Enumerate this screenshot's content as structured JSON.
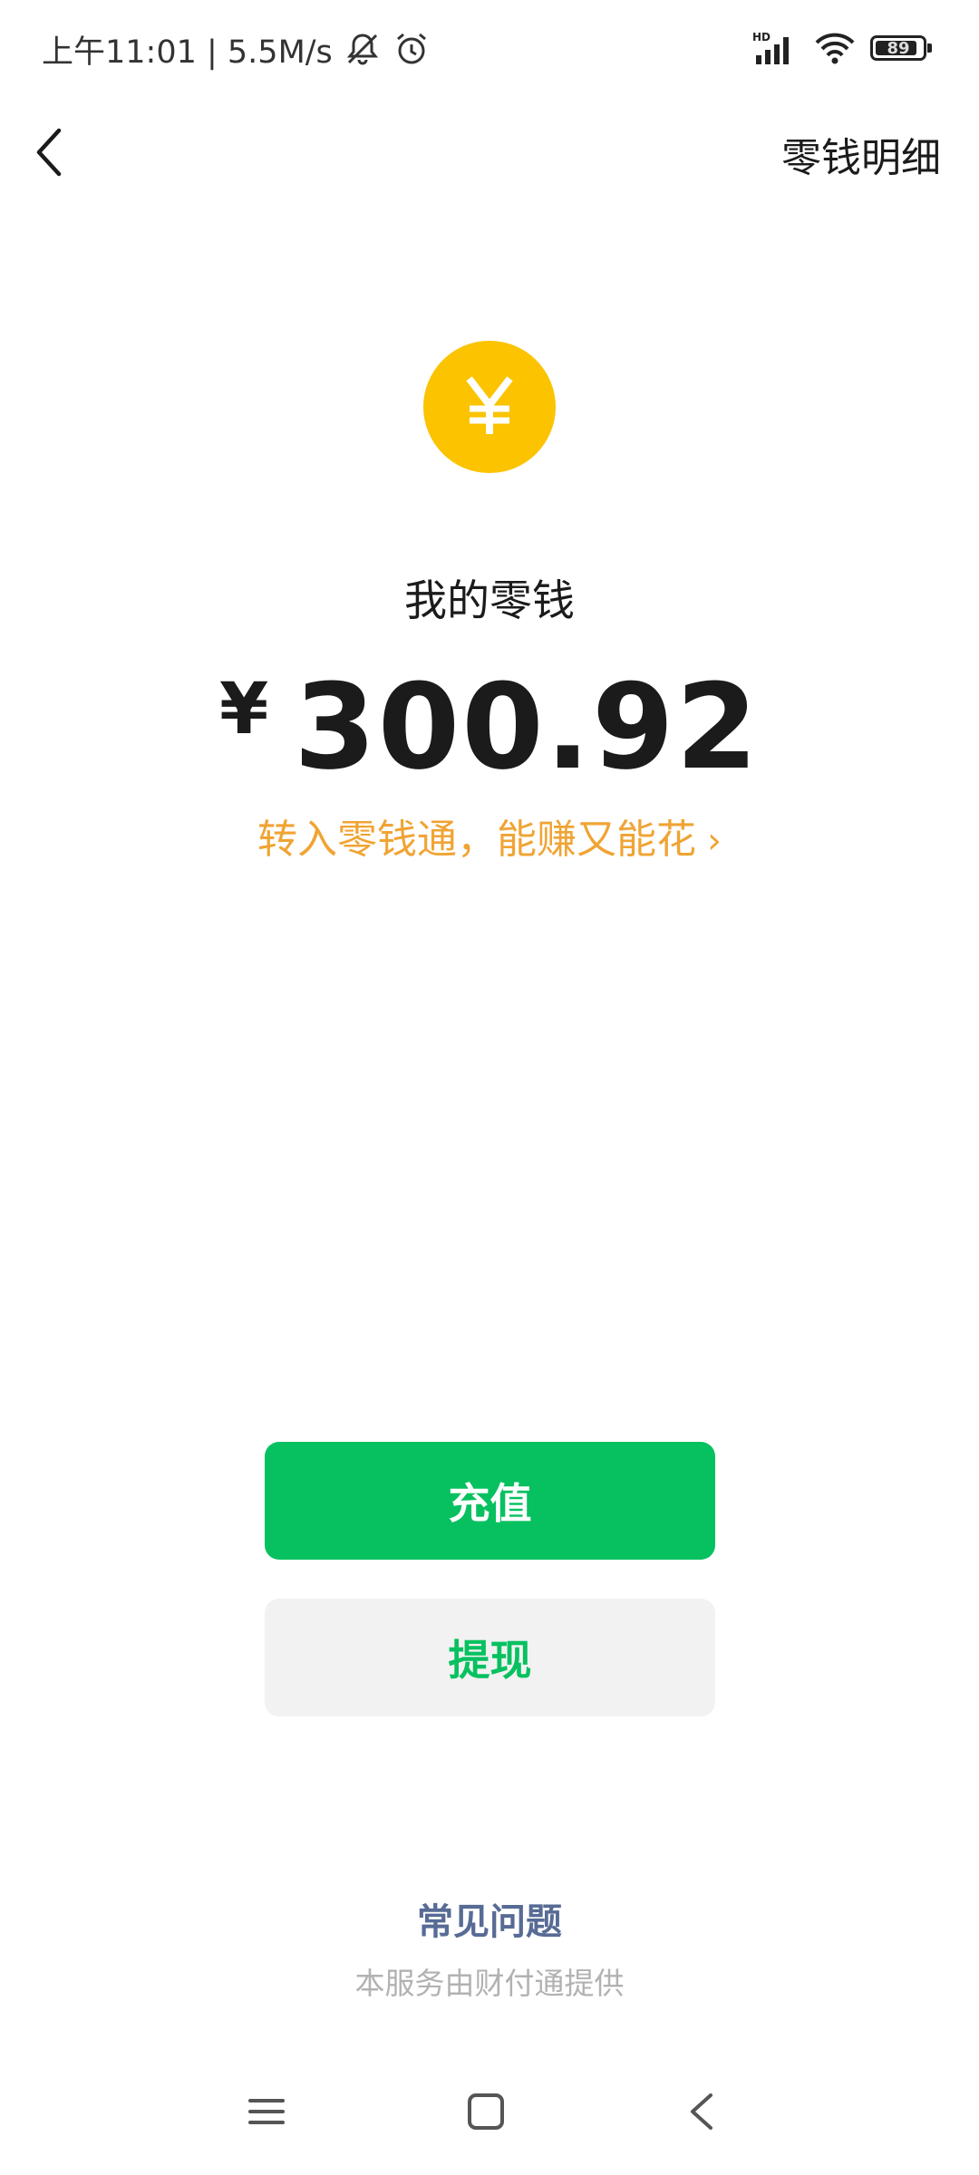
{
  "status_bar": {
    "time_speed": "上午11:01 | 5.5M/s",
    "signal_badge": "HD",
    "battery_level": 89,
    "battery_text": "89"
  },
  "nav": {
    "detail_label": "零钱明细"
  },
  "wallet": {
    "coin_glyph": "¥",
    "label": "我的零钱",
    "currency": "¥",
    "amount": "300.92",
    "promo_text": "转入零钱通，能赚又能花",
    "promo_chevron": "›"
  },
  "actions": {
    "topup_label": "充值",
    "withdraw_label": "提现"
  },
  "footer": {
    "faq_label": "常见问题",
    "provider_text": "本服务由财付通提供"
  },
  "colors": {
    "brand_green": "#07c160",
    "coin_yellow": "#fbc300",
    "promo_orange": "#f0a434",
    "link_blue": "#576b95"
  },
  "icons": {
    "back": "chevron-left-icon",
    "coin": "yuan-coin-icon",
    "mute": "bell-off-icon",
    "alarm": "alarm-clock-icon",
    "signal": "cellular-signal-icon",
    "wifi": "wifi-icon",
    "battery": "battery-icon",
    "sys_menu": "menu-icon",
    "sys_home": "home-square-icon",
    "sys_back": "back-triangle-icon"
  }
}
